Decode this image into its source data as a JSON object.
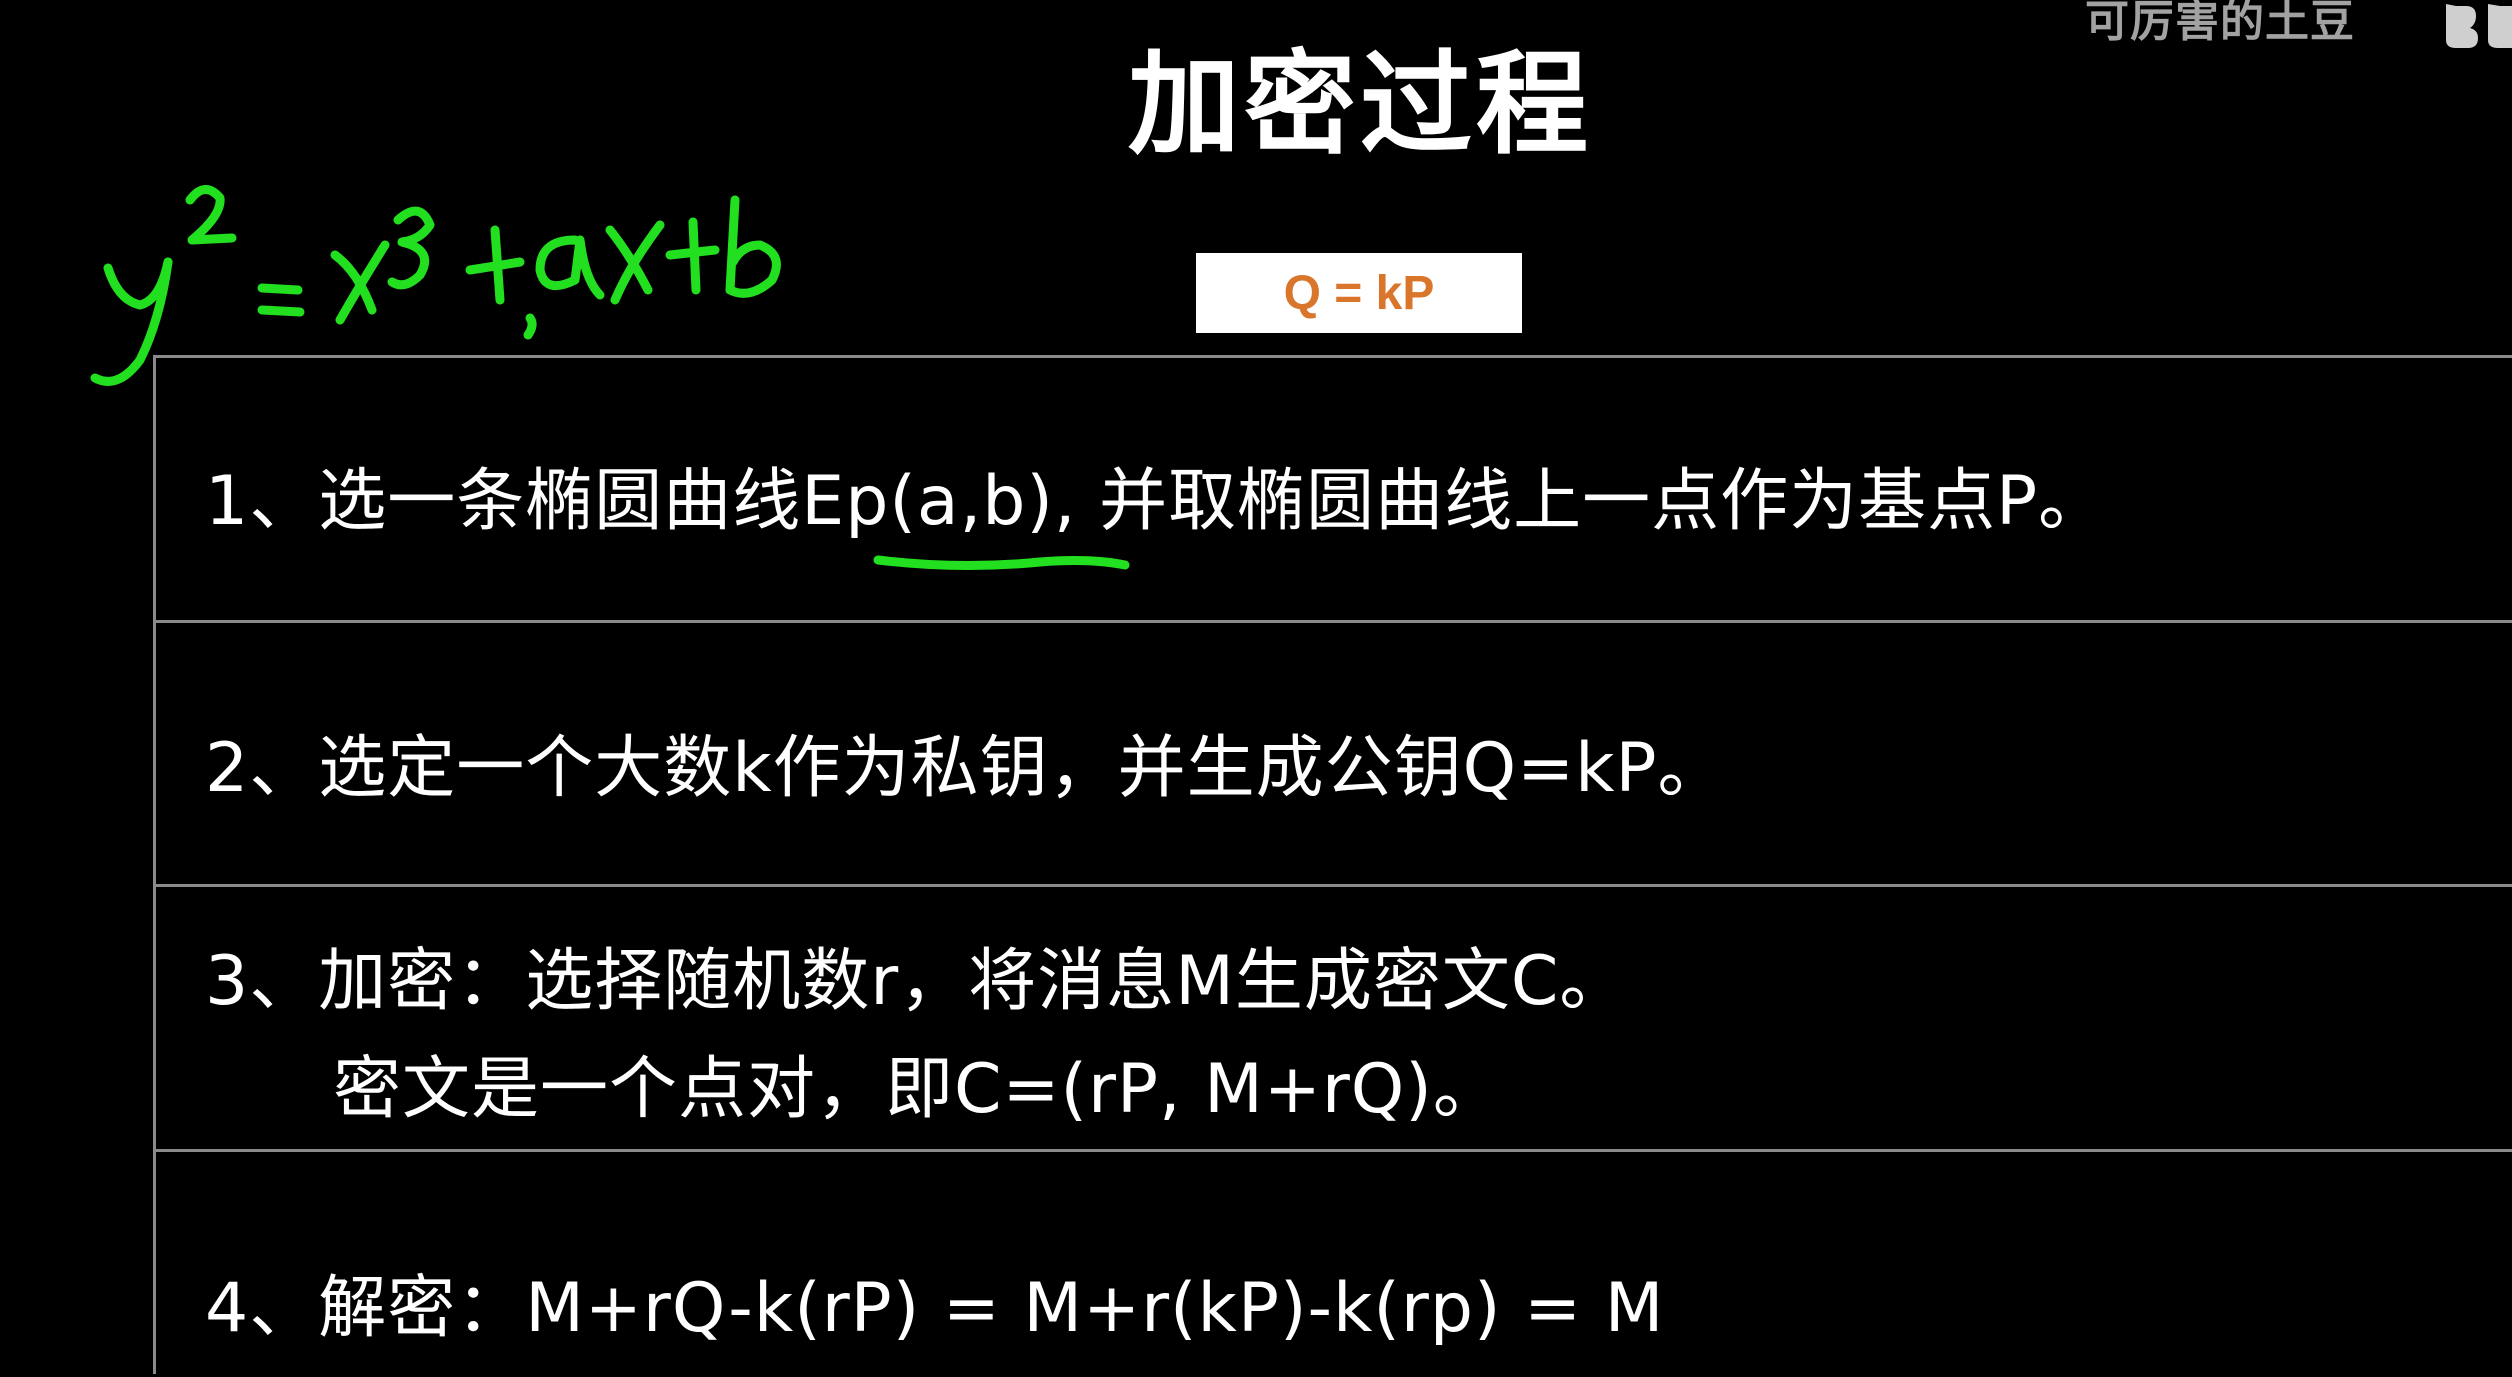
{
  "watermark": {
    "text": "可厉害的土豆"
  },
  "title": "加密过程",
  "formula_box": {
    "text": "Q = kP"
  },
  "steps": [
    {
      "text": "1、选一条椭圆曲线Ep(a,b), 并取椭圆曲线上一点作为基点P。"
    },
    {
      "text": "2、选定一个大数k作为私钥，并生成公钥Q=kP。"
    },
    {
      "text_line1": "3、加密：选择随机数r，将消息M生成密文C。",
      "text_line2": "密文是一个点对，即C=(rP, M+rQ)。"
    },
    {
      "text": "4、解密：M+rQ-k(rP) = M+r(kP)-k(rp) = M"
    }
  ],
  "colors": {
    "background": "#000000",
    "text": "#ffffff",
    "formula_text": "#d9762b",
    "formula_bg": "#ffffff",
    "table_lines": "#8a8a8a",
    "annotation_green": "#22e01f"
  }
}
